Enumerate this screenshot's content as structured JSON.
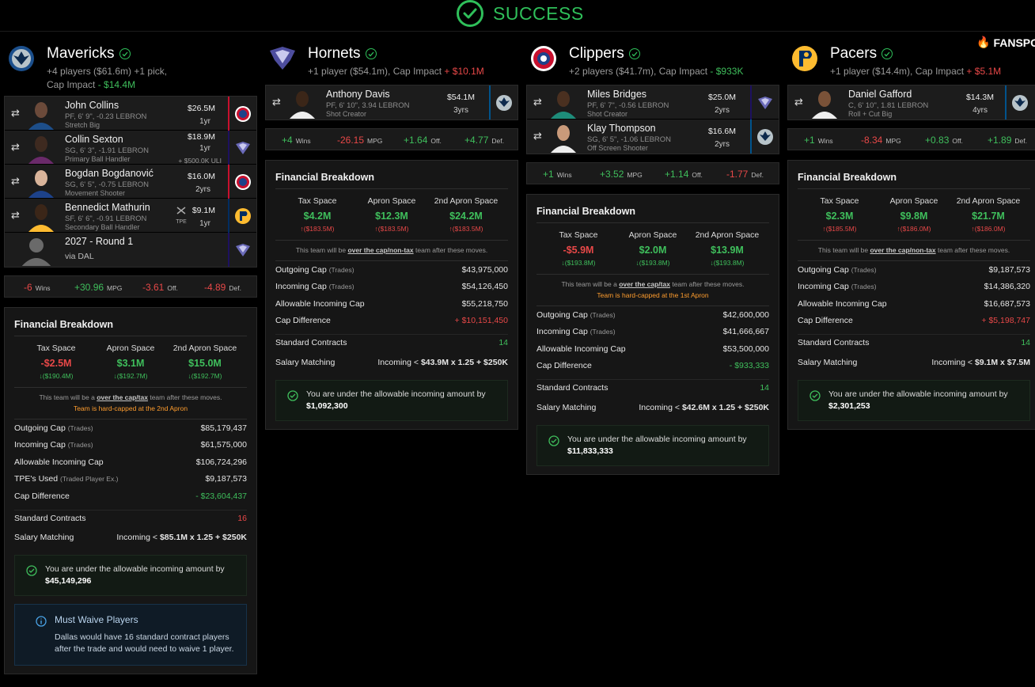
{
  "banner": {
    "text": "SUCCESS"
  },
  "brand": {
    "text": "FANSPO"
  },
  "colors": {
    "positive": "#3fbf5c",
    "negative": "#e84848",
    "warning": "#ff9d2e",
    "accent_success": "#2fbf5a"
  },
  "teams": [
    {
      "name": "Mavericks",
      "logo": "mavericks-logo",
      "summary_prefix": "+4 players ($61.6m) +1 pick,",
      "summary_mid": "Cap Impact",
      "cap_impact": "- $14.4M",
      "players": [
        {
          "name": "John Collins",
          "meta": "PF, 6' 9\", -0.23 LEBRON",
          "role": "Stretch Big",
          "salary": "$26.5M",
          "years": "1yr",
          "dest_logo": "clippers-logo"
        },
        {
          "name": "Collin Sexton",
          "meta": "SG, 6' 3\", -1.91 LEBRON",
          "role": "Primary Ball Handler",
          "salary": "$18.9M",
          "years": "1yr",
          "extra": "+ $500.0K ULI",
          "dest_logo": "hornets-logo"
        },
        {
          "name": "Bogdan Bogdanović",
          "meta": "SG, 6' 5\", -0.75 LEBRON",
          "role": "Movement Shooter",
          "salary": "$16.0M",
          "years": "2yrs",
          "dest_logo": "clippers-logo"
        },
        {
          "name": "Bennedict Mathurin",
          "meta": "SF, 6' 6\", -0.91 LEBRON",
          "role": "Secondary Ball Handler",
          "salary": "$9.1M",
          "years": "1yr",
          "tpe": "TPE",
          "dest_logo": "pacers-logo"
        },
        {
          "name": "2027 - Round 1",
          "meta": "via DAL",
          "dest_logo": "hornets-logo"
        }
      ],
      "impact": {
        "wins": "-6",
        "wins_label": "Wins",
        "mpg": "+30.96",
        "mpg_label": "MPG",
        "off": "-3.61",
        "off_label": "Off.",
        "def": "-4.89",
        "def_label": "Def."
      },
      "financial": {
        "title": "Financial Breakdown",
        "spaces": [
          {
            "label": "Tax Space",
            "value": "-$2.5M",
            "sub": "↓($190.4M)"
          },
          {
            "label": "Apron Space",
            "value": "$3.1M",
            "sub": "↓($192.7M)"
          },
          {
            "label": "2nd Apron Space",
            "value": "$15.0M",
            "sub": "↓($192.7M)"
          }
        ],
        "note_pre": "This team will be a",
        "note_link": "over the cap/tax",
        "note_post": "team after these moves.",
        "hardcap": "Team is hard-capped at the 2nd Apron",
        "rows": [
          {
            "label": "Outgoing Cap",
            "sub": "(Trades)",
            "value": "$85,179,437"
          },
          {
            "label": "Incoming Cap",
            "sub": "(Trades)",
            "value": "$61,575,000"
          },
          {
            "label": "Allowable Incoming Cap",
            "sub": "",
            "value": "$106,724,296"
          },
          {
            "label": "TPE's Used",
            "sub": "(Traded Player Ex.)",
            "value": "$9,187,573"
          },
          {
            "label": "Cap Difference",
            "sub": "",
            "value": "- $23,604,437"
          }
        ],
        "standard_label": "Standard Contracts",
        "standard_value": "16",
        "matching_label": "Salary Matching",
        "matching_pre": "Incoming <",
        "matching_value": "$85.1M x 1.25 + $250K",
        "ok_text": "You are under the allowable incoming amount by",
        "ok_amount": "$45,149,296",
        "info_title": "Must Waive Players",
        "info_text": "Dallas would have 16 standard contract players after the trade and would need to waive 1 player."
      }
    },
    {
      "name": "Hornets",
      "logo": "hornets-logo",
      "summary_prefix": "+1 player ($54.1m), Cap Impact",
      "cap_impact": "+ $10.1M",
      "players": [
        {
          "name": "Anthony Davis",
          "meta": "PF, 6' 10\", 3.94 LEBRON",
          "role": "Shot Creator",
          "salary": "$54.1M",
          "years": "3yrs",
          "dest_logo": "mavericks-logo"
        }
      ],
      "impact": {
        "wins": "+4",
        "wins_label": "Wins",
        "mpg": "-26.15",
        "mpg_label": "MPG",
        "off": "+1.64",
        "off_label": "Off.",
        "def": "+4.77",
        "def_label": "Def."
      },
      "financial": {
        "title": "Financial Breakdown",
        "spaces": [
          {
            "label": "Tax Space",
            "value": "$4.2M",
            "sub": "↑($183.5M)"
          },
          {
            "label": "Apron Space",
            "value": "$12.3M",
            "sub": "↑($183.5M)"
          },
          {
            "label": "2nd Apron Space",
            "value": "$24.2M",
            "sub": "↑($183.5M)"
          }
        ],
        "note_pre": "This team will be",
        "note_link": "over the cap/non-tax",
        "note_post": "team after these moves.",
        "rows": [
          {
            "label": "Outgoing Cap",
            "sub": "(Trades)",
            "value": "$43,975,000"
          },
          {
            "label": "Incoming Cap",
            "sub": "(Trades)",
            "value": "$54,126,450"
          },
          {
            "label": "Allowable Incoming Cap",
            "sub": "",
            "value": "$55,218,750"
          },
          {
            "label": "Cap Difference",
            "sub": "",
            "value": "+ $10,151,450"
          }
        ],
        "standard_label": "Standard Contracts",
        "standard_value": "14",
        "matching_label": "Salary Matching",
        "matching_pre": "Incoming <",
        "matching_value": "$43.9M x 1.25 + $250K",
        "ok_text": "You are under the allowable incoming amount by",
        "ok_amount": "$1,092,300"
      }
    },
    {
      "name": "Clippers",
      "logo": "clippers-logo",
      "summary_prefix": "+2 players ($41.7m), Cap Impact",
      "cap_impact": "- $933K",
      "players": [
        {
          "name": "Miles Bridges",
          "meta": "PF, 6' 7\", -0.56 LEBRON",
          "role": "Shot Creator",
          "salary": "$25.0M",
          "years": "2yrs",
          "dest_logo": "hornets-logo"
        },
        {
          "name": "Klay Thompson",
          "meta": "SG, 6' 5\", -1.06 LEBRON",
          "role": "Off Screen Shooter",
          "salary": "$16.6M",
          "years": "2yrs",
          "dest_logo": "mavericks-logo"
        }
      ],
      "impact": {
        "wins": "+1",
        "wins_label": "Wins",
        "mpg": "+3.52",
        "mpg_label": "MPG",
        "off": "+1.14",
        "off_label": "Off.",
        "def": "-1.77",
        "def_label": "Def."
      },
      "financial": {
        "title": "Financial Breakdown",
        "spaces": [
          {
            "label": "Tax Space",
            "value": "-$5.9M",
            "sub": "↓($193.8M)"
          },
          {
            "label": "Apron Space",
            "value": "$2.0M",
            "sub": "↓($193.8M)"
          },
          {
            "label": "2nd Apron Space",
            "value": "$13.9M",
            "sub": "↓($193.8M)"
          }
        ],
        "note_pre": "This team will be a",
        "note_link": "over the cap/tax",
        "note_post": "team after these moves.",
        "hardcap": "Team is hard-capped at the 1st Apron",
        "rows": [
          {
            "label": "Outgoing Cap",
            "sub": "(Trades)",
            "value": "$42,600,000"
          },
          {
            "label": "Incoming Cap",
            "sub": "(Trades)",
            "value": "$41,666,667"
          },
          {
            "label": "Allowable Incoming Cap",
            "sub": "",
            "value": "$53,500,000"
          },
          {
            "label": "Cap Difference",
            "sub": "",
            "value": "- $933,333"
          }
        ],
        "standard_label": "Standard Contracts",
        "standard_value": "14",
        "matching_label": "Salary Matching",
        "matching_pre": "Incoming <",
        "matching_value": "$42.6M x 1.25 + $250K",
        "ok_text": "You are under the allowable incoming amount by",
        "ok_amount": "$11,833,333"
      }
    },
    {
      "name": "Pacers",
      "logo": "pacers-logo",
      "summary_prefix": "+1 player ($14.4m), Cap Impact",
      "cap_impact": "+ $5.1M",
      "players": [
        {
          "name": "Daniel Gafford",
          "meta": "C, 6' 10\", 1.81 LEBRON",
          "role": "Roll + Cut Big",
          "salary": "$14.3M",
          "years": "4yrs",
          "dest_logo": "mavericks-logo"
        }
      ],
      "impact": {
        "wins": "+1",
        "wins_label": "Wins",
        "mpg": "-8.34",
        "mpg_label": "MPG",
        "off": "+0.83",
        "off_label": "Off.",
        "def": "+1.89",
        "def_label": "Def."
      },
      "financial": {
        "title": "Financial Breakdown",
        "spaces": [
          {
            "label": "Tax Space",
            "value": "$2.3M",
            "sub": "↑($185.5M)"
          },
          {
            "label": "Apron Space",
            "value": "$9.8M",
            "sub": "↑($186.0M)"
          },
          {
            "label": "2nd Apron Space",
            "value": "$21.7M",
            "sub": "↑($186.0M)"
          }
        ],
        "note_pre": "This team will be",
        "note_link": "over the cap/non-tax",
        "note_post": "team after these moves.",
        "rows": [
          {
            "label": "Outgoing Cap",
            "sub": "(Trades)",
            "value": "$9,187,573"
          },
          {
            "label": "Incoming Cap",
            "sub": "(Trades)",
            "value": "$14,386,320"
          },
          {
            "label": "Allowable Incoming Cap",
            "sub": "",
            "value": "$16,687,573"
          },
          {
            "label": "Cap Difference",
            "sub": "",
            "value": "+ $5,198,747"
          }
        ],
        "standard_label": "Standard Contracts",
        "standard_value": "14",
        "matching_label": "Salary Matching",
        "matching_pre": "Incoming <",
        "matching_value": "$9.1M x $7.5M",
        "ok_text": "You are under the allowable incoming amount by",
        "ok_amount": "$2,301,253"
      }
    }
  ]
}
